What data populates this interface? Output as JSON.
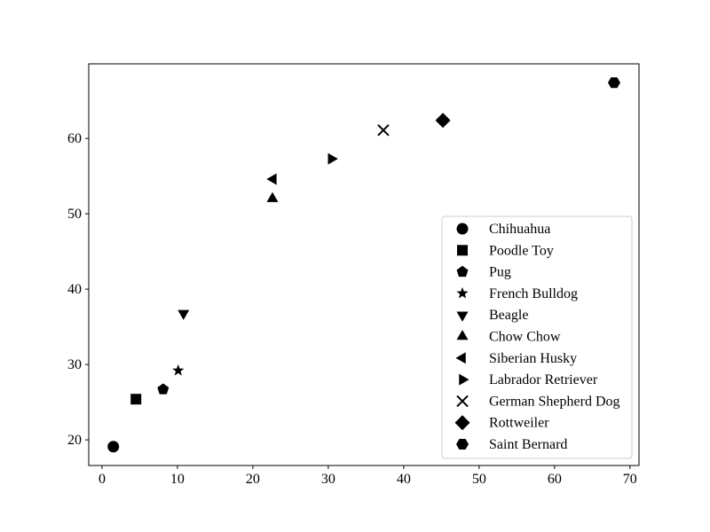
{
  "chart_data": {
    "type": "scatter",
    "title": "",
    "xlabel": "",
    "ylabel": "",
    "xlim": [
      -1.76,
      71.2
    ],
    "ylim": [
      16.6,
      69.9
    ],
    "xticks": [
      0,
      10,
      20,
      30,
      40,
      50,
      60,
      70
    ],
    "yticks": [
      20,
      30,
      40,
      50,
      60
    ],
    "grid": false,
    "legend_position": "lower-right",
    "color": "#000000",
    "series": [
      {
        "name": "Chihuahua",
        "marker": "circle",
        "x": 1.5,
        "y": 19.1
      },
      {
        "name": "Poodle Toy",
        "marker": "square",
        "x": 4.5,
        "y": 25.4
      },
      {
        "name": "Pug",
        "marker": "pentagon",
        "x": 8.1,
        "y": 26.7
      },
      {
        "name": "French Bulldog",
        "marker": "star",
        "x": 10.1,
        "y": 29.2
      },
      {
        "name": "Beagle",
        "marker": "triangle-down",
        "x": 10.8,
        "y": 36.8
      },
      {
        "name": "Chow Chow",
        "marker": "triangle-up",
        "x": 22.6,
        "y": 52.0
      },
      {
        "name": "Siberian Husky",
        "marker": "triangle-left",
        "x": 22.7,
        "y": 54.6
      },
      {
        "name": "Labrador Retriever",
        "marker": "triangle-right",
        "x": 30.4,
        "y": 57.3
      },
      {
        "name": "German Shepherd Dog",
        "marker": "x",
        "x": 37.3,
        "y": 61.1
      },
      {
        "name": "Rottweiler",
        "marker": "diamond",
        "x": 45.2,
        "y": 62.4
      },
      {
        "name": "Saint Bernard",
        "marker": "hexagon",
        "x": 67.9,
        "y": 67.4
      }
    ]
  }
}
